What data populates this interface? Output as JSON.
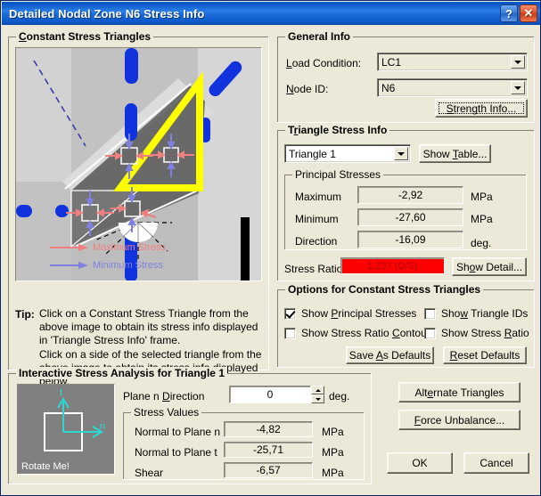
{
  "window": {
    "title": "Detailed Nodal Zone N6 Stress Info",
    "help_button": "?",
    "close_button": "✕"
  },
  "constant_stress_triangles": {
    "group_title": "Constant Stress Triangles",
    "legend": [
      {
        "label": "Maximum Stress",
        "color": "#f08080"
      },
      {
        "label": "Minimum Stress",
        "color": "#8080e0"
      }
    ],
    "tip_label": "Tip:",
    "tip_paragraph_1": "Click on a Constant Stress Triangle from the above image to obtain its stress info displayed in 'Triangle Stress Info' frame.",
    "tip_paragraph_2": "Click on a side of the selected triangle from the above image to obtain its stress info displayed below."
  },
  "general_info": {
    "group_title": "General Info",
    "load_condition_label": "Load Condition:",
    "load_condition_value": "LC1",
    "node_id_label": "Node ID:",
    "node_id_value": "N6",
    "strength_info_button": "Strength Info..."
  },
  "triangle_stress_info": {
    "group_title": "Triangle Stress Info",
    "triangle_select_value": "Triangle 1",
    "show_table_button": "Show Table...",
    "principal_stresses": {
      "group_title": "Principal Stresses",
      "rows": [
        {
          "label": "Maximum",
          "value": "-2,92",
          "unit": "MPa"
        },
        {
          "label": "Minimum",
          "value": "-27,60",
          "unit": "MPa"
        },
        {
          "label": "Direction",
          "value": "-16,09",
          "unit": "deg."
        }
      ]
    },
    "stress_ratio_label": "Stress Ratio",
    "stress_ratio_value": "1,237 (O/S)",
    "stress_ratio_color": "#ff0000",
    "show_detail_button": "Show Detail..."
  },
  "options": {
    "group_title": "Options for Constant Stress Triangles",
    "checkboxes": [
      {
        "label": "Show Principal Stresses",
        "checked": true
      },
      {
        "label": "Show Triangle IDs",
        "checked": false
      },
      {
        "label": "Show Stress Ratio Contour",
        "checked": false
      },
      {
        "label": "Show Stress Ratio",
        "checked": false
      }
    ],
    "save_defaults_button": "Save As Defaults",
    "reset_defaults_button": "Reset Defaults"
  },
  "interactive": {
    "group_title": "Interactive Stress Analysis for Triangle 1",
    "preview_label": "Rotate Me!",
    "axis_t_label": "t",
    "axis_n_label": "n",
    "plane_direction_label": "Plane n Direction",
    "plane_direction_value": "0",
    "plane_direction_unit": "deg.",
    "stress_values": {
      "group_title": "Stress Values",
      "rows": [
        {
          "label": "Normal to Plane n",
          "value": "-4,82",
          "unit": "MPa"
        },
        {
          "label": "Normal to Plane t",
          "value": "-25,71",
          "unit": "MPa"
        },
        {
          "label": "Shear",
          "value": "-6,57",
          "unit": "MPa"
        }
      ]
    }
  },
  "actions": {
    "alternate_triangles_button": "Alternate Triangles",
    "force_unbalance_button": "Force Unbalance...",
    "ok_button": "OK",
    "cancel_button": "Cancel"
  }
}
